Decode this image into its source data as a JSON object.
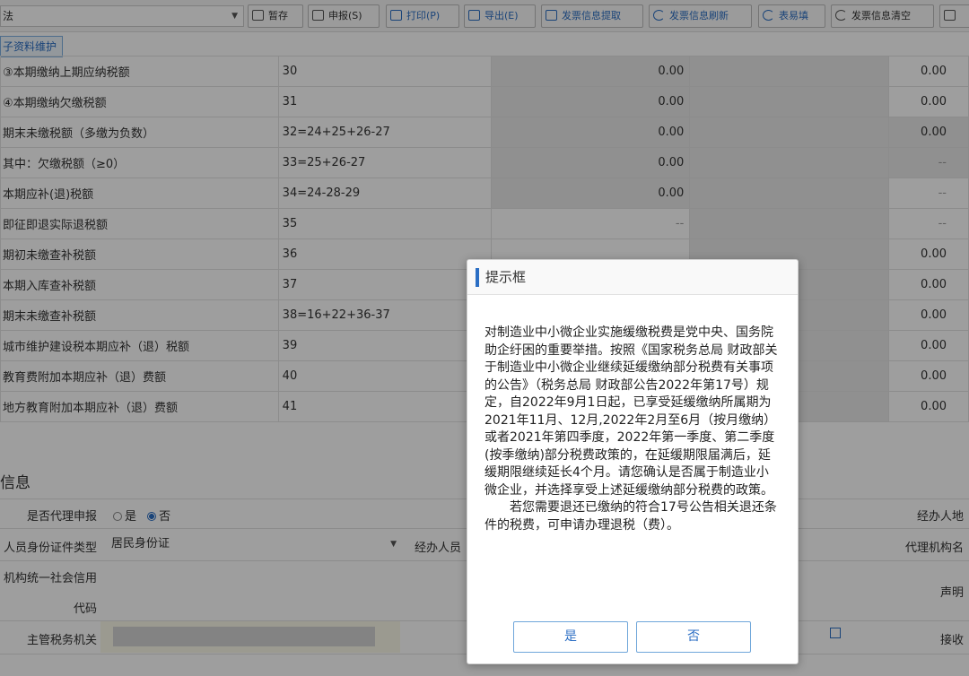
{
  "toolbar": {
    "select_value": "法",
    "buttons": [
      {
        "label": "暂存",
        "icon": "save-icon"
      },
      {
        "label": "申报(S)",
        "icon": "submit-icon"
      },
      {
        "label": "打印(P)",
        "icon": "print-icon"
      },
      {
        "label": "导出(E)",
        "icon": "export-icon"
      },
      {
        "label": "发票信息提取",
        "icon": "extract-icon"
      },
      {
        "label": "发票信息刷新",
        "icon": "refresh-icon"
      },
      {
        "label": "表易填",
        "icon": "search-icon"
      },
      {
        "label": "发票信息清空",
        "icon": "clear-icon"
      }
    ]
  },
  "maint_button": "子资料维护",
  "rows": [
    {
      "label": "③本期缴纳上期应纳税额",
      "formula": "30",
      "v1": "0.00",
      "v2": "0.00"
    },
    {
      "label": "④本期缴纳欠缴税额",
      "formula": "31",
      "v1": "0.00",
      "v2": "0.00"
    },
    {
      "label": "期末未缴税额（多缴为负数）",
      "formula": "32=24+25+26-27",
      "v1": "0.00",
      "v2": "0.00"
    },
    {
      "label": "其中：欠缴税额（≥0）",
      "formula": "33=25+26-27",
      "v1": "0.00",
      "v2": "--"
    },
    {
      "label": "本期应补(退)税额",
      "formula": "34=24-28-29",
      "v1": "0.00",
      "v2": "--"
    },
    {
      "label": "即征即退实际退税额",
      "formula": "35",
      "v1": "--",
      "v2": "--"
    },
    {
      "label": "期初未缴查补税额",
      "formula": "36",
      "v1": "",
      "v2": "0.00"
    },
    {
      "label": "本期入库查补税额",
      "formula": "37",
      "v1": "",
      "v2": "0.00"
    },
    {
      "label": "期末未缴查补税额",
      "formula": "38=16+22+36-37",
      "v1": "",
      "v2": "0.00"
    },
    {
      "label": "城市维护建设税本期应补（退）税额",
      "formula": "39",
      "v1": "",
      "v2": "0.00"
    },
    {
      "label": "教育费附加本期应补（退）费额",
      "formula": "40",
      "v1": "",
      "v2": "0.00"
    },
    {
      "label": "地方教育附加本期应补（退）费额",
      "formula": "41",
      "v1": "",
      "v2": "0.00"
    }
  ],
  "info": {
    "section_title": "信息",
    "agent_label": "是否代理申报",
    "radio_yes": "是",
    "radio_no": "否",
    "id_type_label": "人员身份证件类型",
    "id_type_value": "居民身份证",
    "agent_person_label": "经办人员",
    "org_code_label_1": "机构统一社会信用",
    "org_code_label_2": "代码",
    "tax_office_label": "主管税务机关",
    "right_label_1": "经办人地",
    "right_label_2": "代理机构名",
    "right_label_3": "声明",
    "right_label_4": "接收"
  },
  "dialog": {
    "title": "提示框",
    "paragraph1": "对制造业中小微企业实施缓缴税费是党中央、国务院助企纡困的重要举措。按照《国家税务总局 财政部关于制造业中小微企业继续延缓缴纳部分税费有关事项的公告》（税务总局 财政部公告2022年第17号）规定，自2022年9月1日起，已享受延缓缴纳所属期为2021年11月、12月,2022年2月至6月（按月缴纳）或者2021年第四季度，2022年第一季度、第二季度(按季缴纳)部分税费政策的，在延缓期限届满后，延缓期限继续延长4个月。请您确认是否属于制造业小微企业，并选择享受上述延缓缴纳部分税费的政策。",
    "paragraph2": "　　若您需要退还已缴纳的符合17号公告相关退还条件的税费，可申请办理退税（费）。",
    "yes_label": "是",
    "no_label": "否"
  }
}
